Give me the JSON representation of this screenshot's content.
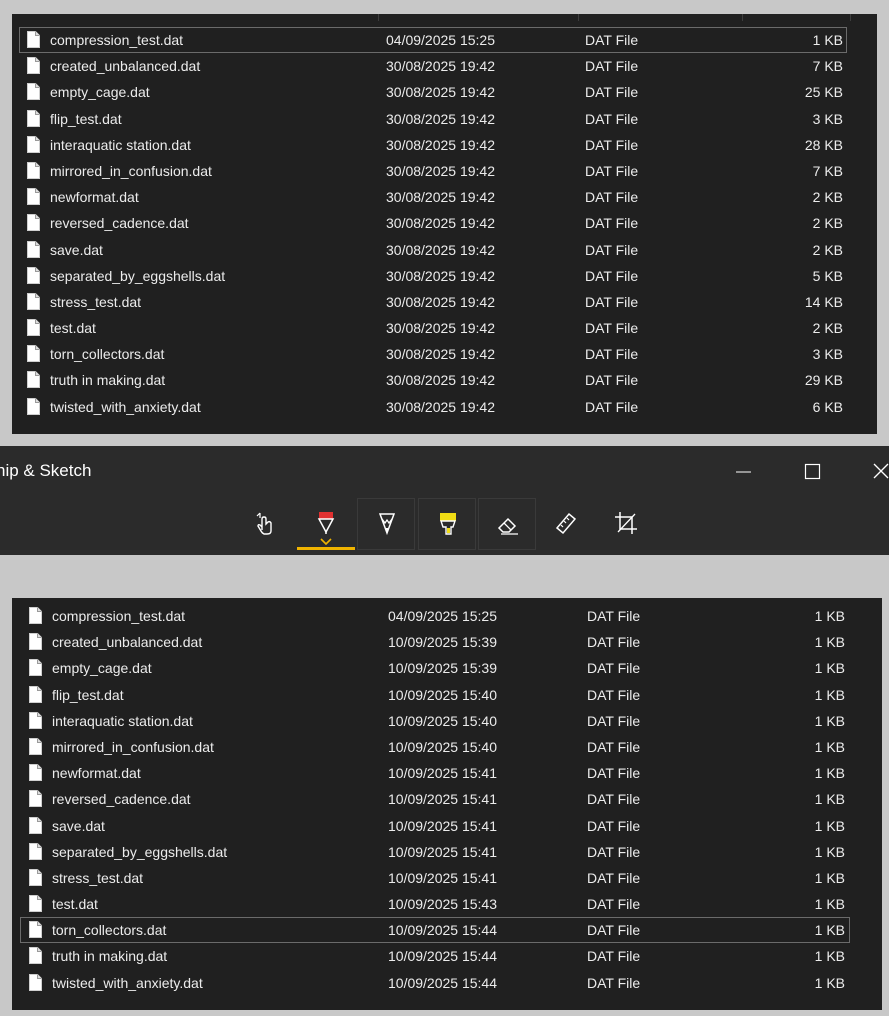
{
  "colors": {
    "panel_bg": "#202020",
    "text": "#ececec",
    "accent": "#f0b400",
    "pen_red": "#e03030",
    "highlighter_yellow": "#f0dc14",
    "page_bg": "#c8c8c8",
    "window_bg": "#2b2b2b"
  },
  "top_list": {
    "selected_index": 0,
    "files": [
      {
        "name": "compression_test.dat",
        "date": "04/09/2025 15:25",
        "type": "DAT File",
        "size": "1 KB"
      },
      {
        "name": "created_unbalanced.dat",
        "date": "30/08/2025 19:42",
        "type": "DAT File",
        "size": "7 KB"
      },
      {
        "name": "empty_cage.dat",
        "date": "30/08/2025 19:42",
        "type": "DAT File",
        "size": "25 KB"
      },
      {
        "name": "flip_test.dat",
        "date": "30/08/2025 19:42",
        "type": "DAT File",
        "size": "3 KB"
      },
      {
        "name": "interaquatic station.dat",
        "date": "30/08/2025 19:42",
        "type": "DAT File",
        "size": "28 KB"
      },
      {
        "name": "mirrored_in_confusion.dat",
        "date": "30/08/2025 19:42",
        "type": "DAT File",
        "size": "7 KB"
      },
      {
        "name": "newformat.dat",
        "date": "30/08/2025 19:42",
        "type": "DAT File",
        "size": "2 KB"
      },
      {
        "name": "reversed_cadence.dat",
        "date": "30/08/2025 19:42",
        "type": "DAT File",
        "size": "2 KB"
      },
      {
        "name": "save.dat",
        "date": "30/08/2025 19:42",
        "type": "DAT File",
        "size": "2 KB"
      },
      {
        "name": "separated_by_eggshells.dat",
        "date": "30/08/2025 19:42",
        "type": "DAT File",
        "size": "5 KB"
      },
      {
        "name": "stress_test.dat",
        "date": "30/08/2025 19:42",
        "type": "DAT File",
        "size": "14 KB"
      },
      {
        "name": "test.dat",
        "date": "30/08/2025 19:42",
        "type": "DAT File",
        "size": "2 KB"
      },
      {
        "name": "torn_collectors.dat",
        "date": "30/08/2025 19:42",
        "type": "DAT File",
        "size": "3 KB"
      },
      {
        "name": "truth in making.dat",
        "date": "30/08/2025 19:42",
        "type": "DAT File",
        "size": "29 KB"
      },
      {
        "name": "twisted_with_anxiety.dat",
        "date": "30/08/2025 19:42",
        "type": "DAT File",
        "size": "6 KB"
      }
    ]
  },
  "snip_window": {
    "title": "nip & Sketch",
    "controls": [
      {
        "name": "minimize-button",
        "icon": "minimize-icon"
      },
      {
        "name": "maximize-button",
        "icon": "maximize-icon"
      },
      {
        "name": "close-button",
        "icon": "close-icon"
      }
    ],
    "tools": [
      {
        "name": "touch-writing-button",
        "icon": "touch-writing-icon",
        "active": false,
        "framed": false
      },
      {
        "name": "ballpoint-pen-button",
        "icon": "ballpoint-pen-icon",
        "active": true,
        "framed": false
      },
      {
        "name": "pencil-button",
        "icon": "pencil-icon",
        "active": false,
        "framed": true
      },
      {
        "name": "highlighter-button",
        "icon": "highlighter-icon",
        "active": false,
        "framed": true
      },
      {
        "name": "eraser-button",
        "icon": "eraser-icon",
        "active": false,
        "framed": true
      },
      {
        "name": "ruler-button",
        "icon": "ruler-icon",
        "active": false,
        "framed": false
      },
      {
        "name": "crop-button",
        "icon": "crop-icon",
        "active": false,
        "framed": false
      }
    ]
  },
  "bottom_list": {
    "selected_index": 12,
    "files": [
      {
        "name": "compression_test.dat",
        "date": "04/09/2025 15:25",
        "type": "DAT File",
        "size": "1 KB"
      },
      {
        "name": "created_unbalanced.dat",
        "date": "10/09/2025 15:39",
        "type": "DAT File",
        "size": "1 KB"
      },
      {
        "name": "empty_cage.dat",
        "date": "10/09/2025 15:39",
        "type": "DAT File",
        "size": "1 KB"
      },
      {
        "name": "flip_test.dat",
        "date": "10/09/2025 15:40",
        "type": "DAT File",
        "size": "1 KB"
      },
      {
        "name": "interaquatic station.dat",
        "date": "10/09/2025 15:40",
        "type": "DAT File",
        "size": "1 KB"
      },
      {
        "name": "mirrored_in_confusion.dat",
        "date": "10/09/2025 15:40",
        "type": "DAT File",
        "size": "1 KB"
      },
      {
        "name": "newformat.dat",
        "date": "10/09/2025 15:41",
        "type": "DAT File",
        "size": "1 KB"
      },
      {
        "name": "reversed_cadence.dat",
        "date": "10/09/2025 15:41",
        "type": "DAT File",
        "size": "1 KB"
      },
      {
        "name": "save.dat",
        "date": "10/09/2025 15:41",
        "type": "DAT File",
        "size": "1 KB"
      },
      {
        "name": "separated_by_eggshells.dat",
        "date": "10/09/2025 15:41",
        "type": "DAT File",
        "size": "1 KB"
      },
      {
        "name": "stress_test.dat",
        "date": "10/09/2025 15:41",
        "type": "DAT File",
        "size": "1 KB"
      },
      {
        "name": "test.dat",
        "date": "10/09/2025 15:43",
        "type": "DAT File",
        "size": "1 KB"
      },
      {
        "name": "torn_collectors.dat",
        "date": "10/09/2025 15:44",
        "type": "DAT File",
        "size": "1 KB"
      },
      {
        "name": "truth in making.dat",
        "date": "10/09/2025 15:44",
        "type": "DAT File",
        "size": "1 KB"
      },
      {
        "name": "twisted_with_anxiety.dat",
        "date": "10/09/2025 15:44",
        "type": "DAT File",
        "size": "1 KB"
      }
    ]
  }
}
